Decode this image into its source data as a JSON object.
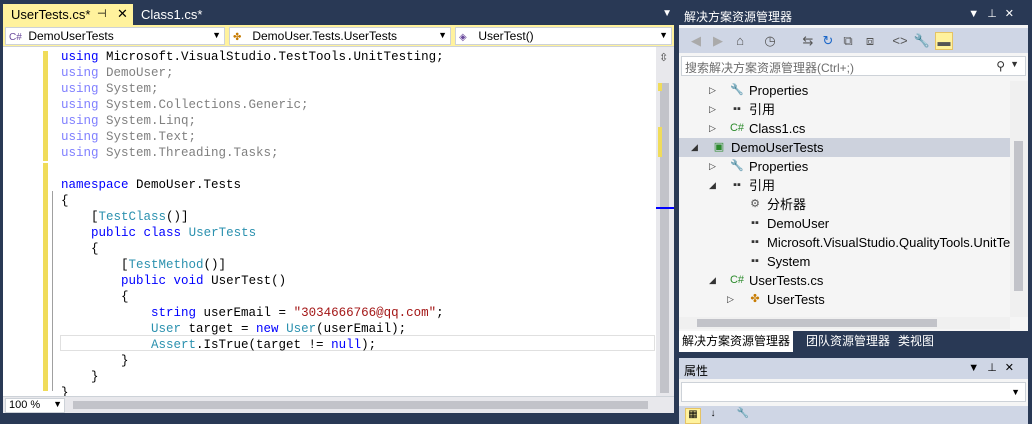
{
  "editor": {
    "tabs": [
      {
        "label": "UserTests.cs*",
        "active": true
      },
      {
        "label": "Class1.cs*",
        "active": false
      }
    ],
    "nav": {
      "project": "DemoUserTests",
      "class": "DemoUser.Tests.UserTests",
      "member": "UserTest()"
    },
    "zoom": "100 %",
    "code_lines": [
      {
        "parts": [
          {
            "t": "using",
            "c": "kw"
          },
          {
            "t": " Microsoft.VisualStudio.TestTools.UnitTesting;",
            "c": ""
          }
        ]
      },
      {
        "parts": [
          {
            "t": "using",
            "c": "kw-dim"
          },
          {
            "t": " DemoUser;",
            "c": "dim"
          }
        ]
      },
      {
        "parts": [
          {
            "t": "using",
            "c": "kw-dim"
          },
          {
            "t": " System;",
            "c": "dim"
          }
        ]
      },
      {
        "parts": [
          {
            "t": "using",
            "c": "kw-dim"
          },
          {
            "t": " System.Collections.Generic;",
            "c": "dim"
          }
        ]
      },
      {
        "parts": [
          {
            "t": "using",
            "c": "kw-dim"
          },
          {
            "t": " System.Linq;",
            "c": "dim"
          }
        ]
      },
      {
        "parts": [
          {
            "t": "using",
            "c": "kw-dim"
          },
          {
            "t": " System.Text;",
            "c": "dim"
          }
        ]
      },
      {
        "parts": [
          {
            "t": "using",
            "c": "kw-dim"
          },
          {
            "t": " System.Threading.Tasks;",
            "c": "dim"
          }
        ]
      },
      {
        "parts": []
      },
      {
        "parts": [
          {
            "t": "namespace",
            "c": "kw"
          },
          {
            "t": " DemoUser.Tests",
            "c": ""
          }
        ]
      },
      {
        "parts": [
          {
            "t": "{",
            "c": ""
          }
        ]
      },
      {
        "parts": [
          {
            "t": "    [",
            "c": ""
          },
          {
            "t": "TestClass",
            "c": "type"
          },
          {
            "t": "()]",
            "c": ""
          }
        ]
      },
      {
        "parts": [
          {
            "t": "    ",
            "c": ""
          },
          {
            "t": "public",
            "c": "kw"
          },
          {
            "t": " ",
            "c": ""
          },
          {
            "t": "class",
            "c": "kw"
          },
          {
            "t": " ",
            "c": ""
          },
          {
            "t": "UserTests",
            "c": "type"
          }
        ]
      },
      {
        "parts": [
          {
            "t": "    {",
            "c": ""
          }
        ]
      },
      {
        "parts": [
          {
            "t": "        [",
            "c": ""
          },
          {
            "t": "TestMethod",
            "c": "type"
          },
          {
            "t": "()]",
            "c": ""
          }
        ]
      },
      {
        "parts": [
          {
            "t": "        ",
            "c": ""
          },
          {
            "t": "public",
            "c": "kw"
          },
          {
            "t": " ",
            "c": ""
          },
          {
            "t": "void",
            "c": "kw"
          },
          {
            "t": " UserTest()",
            "c": ""
          }
        ]
      },
      {
        "parts": [
          {
            "t": "        {",
            "c": ""
          }
        ]
      },
      {
        "parts": [
          {
            "t": "            ",
            "c": ""
          },
          {
            "t": "string",
            "c": "kw"
          },
          {
            "t": " userEmail = ",
            "c": ""
          },
          {
            "t": "\"3034666766@qq.com\"",
            "c": "str"
          },
          {
            "t": ";",
            "c": ""
          }
        ]
      },
      {
        "parts": [
          {
            "t": "            ",
            "c": ""
          },
          {
            "t": "User",
            "c": "type"
          },
          {
            "t": " target = ",
            "c": ""
          },
          {
            "t": "new",
            "c": "kw"
          },
          {
            "t": " ",
            "c": ""
          },
          {
            "t": "User",
            "c": "type"
          },
          {
            "t": "(userEmail);",
            "c": ""
          }
        ]
      },
      {
        "parts": [
          {
            "t": "            ",
            "c": ""
          },
          {
            "t": "Assert",
            "c": "type"
          },
          {
            "t": ".IsTrue(target != ",
            "c": ""
          },
          {
            "t": "null",
            "c": "kw"
          },
          {
            "t": ");",
            "c": ""
          }
        ]
      },
      {
        "parts": [
          {
            "t": "        }",
            "c": ""
          }
        ]
      },
      {
        "parts": [
          {
            "t": "    }",
            "c": ""
          }
        ]
      },
      {
        "parts": [
          {
            "t": "}",
            "c": ""
          }
        ]
      }
    ]
  },
  "solution_explorer": {
    "title": "解决方案资源管理器",
    "search_placeholder": "搜索解决方案资源管理器(Ctrl+;)",
    "tree": [
      {
        "label": "Properties",
        "icon": "wrench-icon",
        "indent": 1,
        "arrow": "collapsed"
      },
      {
        "label": "引用",
        "icon": "references-icon",
        "indent": 1,
        "arrow": "collapsed"
      },
      {
        "label": "Class1.cs",
        "icon": "csharp-file-icon",
        "indent": 1,
        "arrow": "collapsed"
      },
      {
        "label": "DemoUserTests",
        "icon": "test-project-icon",
        "indent": 0,
        "arrow": "expanded",
        "selected": true
      },
      {
        "label": "Properties",
        "icon": "wrench-icon",
        "indent": 1,
        "arrow": "collapsed"
      },
      {
        "label": "引用",
        "icon": "references-icon",
        "indent": 1,
        "arrow": "expanded"
      },
      {
        "label": "分析器",
        "icon": "analyzer-icon",
        "indent": 2,
        "arrow": "none"
      },
      {
        "label": "DemoUser",
        "icon": "reference-icon",
        "indent": 2,
        "arrow": "none"
      },
      {
        "label": "Microsoft.VisualStudio.QualityTools.UnitTe",
        "icon": "reference-icon",
        "indent": 2,
        "arrow": "none"
      },
      {
        "label": "System",
        "icon": "reference-icon",
        "indent": 2,
        "arrow": "none"
      },
      {
        "label": "UserTests.cs",
        "icon": "csharp-file-icon",
        "indent": 1,
        "arrow": "expanded"
      },
      {
        "label": "UserTests",
        "icon": "class-icon",
        "indent": 2,
        "arrow": "collapsed"
      }
    ],
    "bottom_tabs": [
      {
        "label": "解决方案资源管理器",
        "active": true
      },
      {
        "label": "团队资源管理器",
        "active": false
      },
      {
        "label": "类视图",
        "active": false
      }
    ]
  },
  "properties": {
    "title": "属性"
  },
  "colors": {
    "active_tab": "#fff29d",
    "chrome": "#293955",
    "keyword": "#0000ff",
    "type": "#2b91af",
    "string": "#a31515"
  }
}
